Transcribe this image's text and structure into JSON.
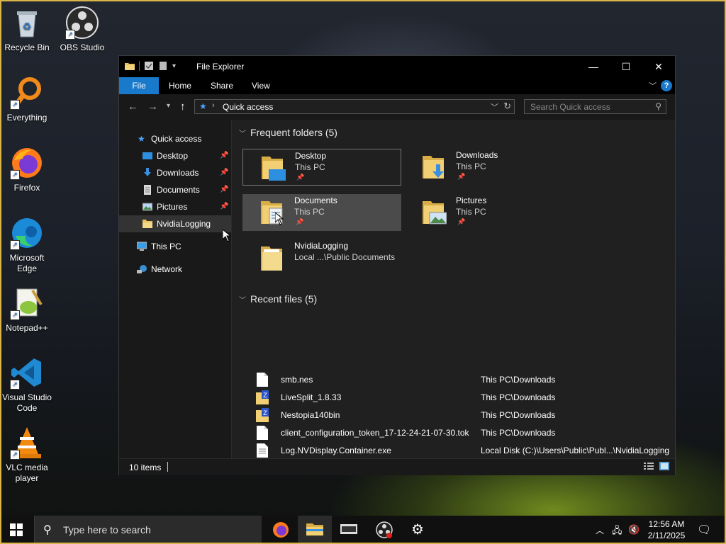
{
  "desktop": {
    "icons": [
      {
        "label": "Recycle Bin",
        "icon": "recycle-bin-icon"
      },
      {
        "label": "OBS Studio",
        "icon": "obs-studio-icon"
      },
      {
        "label": "Everything",
        "icon": "everything-search-icon"
      },
      {
        "label": "Firefox",
        "icon": "firefox-icon"
      },
      {
        "label": "Microsoft Edge",
        "icon": "edge-icon"
      },
      {
        "label": "Notepad++",
        "icon": "notepadpp-icon"
      },
      {
        "label": "Visual Studio Code",
        "icon": "vscode-icon"
      },
      {
        "label": "VLC media player",
        "icon": "vlc-icon"
      }
    ]
  },
  "window": {
    "title": "File Explorer",
    "controls": {
      "minimize": "—",
      "maximize": "☐",
      "close": "✕"
    },
    "ribbon_tabs": [
      "File",
      "Home",
      "Share",
      "View"
    ],
    "help": "?",
    "address": {
      "crumb": "Quick access"
    },
    "search": {
      "placeholder": "Search Quick access"
    },
    "nav": {
      "quick_access": "Quick access",
      "items": [
        {
          "label": "Desktop",
          "pinned": true,
          "icon": "desktop-icon"
        },
        {
          "label": "Downloads",
          "pinned": true,
          "icon": "downloads-icon"
        },
        {
          "label": "Documents",
          "pinned": true,
          "icon": "documents-icon"
        },
        {
          "label": "Pictures",
          "pinned": true,
          "icon": "pictures-icon"
        },
        {
          "label": "NvidiaLogging",
          "pinned": false,
          "icon": "folder-icon"
        }
      ],
      "this_pc": "This PC",
      "network": "Network"
    },
    "frequent": {
      "heading": "Frequent folders (5)",
      "folders": [
        {
          "name": "Desktop",
          "location": "This PC",
          "pinned": true
        },
        {
          "name": "Downloads",
          "location": "This PC",
          "pinned": true
        },
        {
          "name": "Documents",
          "location": "This PC",
          "pinned": true
        },
        {
          "name": "Pictures",
          "location": "This PC",
          "pinned": true
        },
        {
          "name": "NvidiaLogging",
          "location": "Local ...\\Public Documents",
          "pinned": false
        }
      ]
    },
    "recent": {
      "heading": "Recent files (5)",
      "files": [
        {
          "name": "smb.nes",
          "location": "This PC\\Downloads",
          "icon": "file-icon"
        },
        {
          "name": "LiveSplit_1.8.33",
          "location": "This PC\\Downloads",
          "icon": "zip-folder-icon"
        },
        {
          "name": "Nestopia140bin",
          "location": "This PC\\Downloads",
          "icon": "zip-folder-icon"
        },
        {
          "name": "client_configuration_token_17-12-24-21-07-30.tok",
          "location": "This PC\\Downloads",
          "icon": "file-icon"
        },
        {
          "name": "Log.NVDisplay.Container.exe",
          "location": "Local Disk (C:)\\Users\\Public\\Publ...\\NvidiaLogging",
          "icon": "text-file-icon"
        }
      ]
    },
    "status": {
      "item_count": "10 items"
    }
  },
  "taskbar": {
    "search_placeholder": "Type here to search",
    "time": "12:56 AM",
    "date": "2/11/2025"
  },
  "colors": {
    "accent": "#1979ca",
    "folder": "#e8c15a"
  }
}
